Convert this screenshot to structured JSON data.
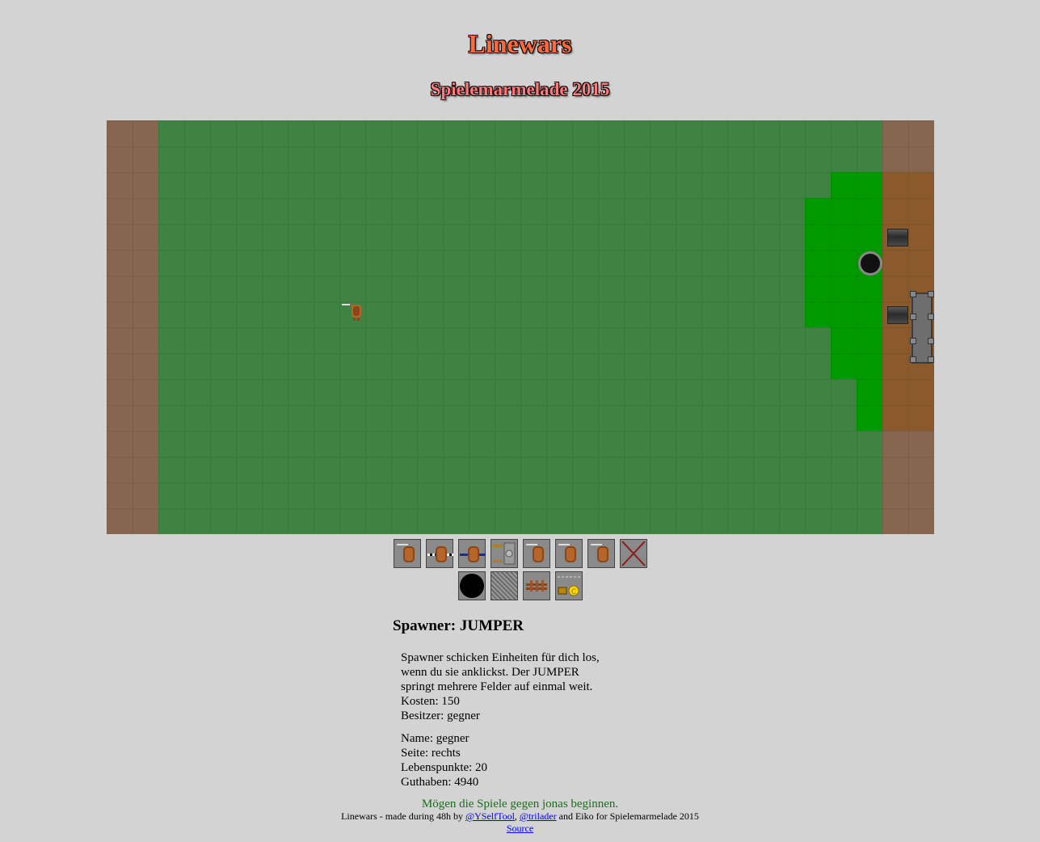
{
  "header": {
    "title": "Linewars",
    "subtitle": "Spielemarmelade 2015"
  },
  "colors": {
    "background": "#d3d3d3",
    "field_grass": "#3f8342",
    "territory_bright_green": "#009900",
    "enemy_dirt": "#8b5a2b",
    "border_dirt": "#86664f",
    "title_orange": "#ff6a3d",
    "greeting_green": "#1e6b1e"
  },
  "board": {
    "icons": [
      "enemy-cannon-icon",
      "black-hole-icon",
      "enemy-base-icon",
      "player-unit-icon"
    ]
  },
  "toolbar": {
    "row1": [
      {
        "name": "spawner-basic-button",
        "icon": "unit-sprite-icon"
      },
      {
        "name": "spawner-jumper-button",
        "icon": "unit-dotted-icon"
      },
      {
        "name": "spawner-line-button",
        "icon": "unit-blue-line-icon"
      },
      {
        "name": "spawner-tank-button",
        "icon": "tank-icon"
      },
      {
        "name": "spawner-unit-5-button",
        "icon": "unit-sprite-icon"
      },
      {
        "name": "spawner-unit-6-button",
        "icon": "unit-sprite-icon"
      },
      {
        "name": "spawner-unit-7-button",
        "icon": "unit-sprite-icon"
      },
      {
        "name": "delete-button",
        "icon": "cross-icon"
      }
    ],
    "row2": [
      {
        "name": "black-hole-button",
        "icon": "black-hole-icon"
      },
      {
        "name": "wall-button",
        "icon": "grid-wall-icon"
      },
      {
        "name": "fence-button",
        "icon": "fence-icon"
      },
      {
        "name": "money-button",
        "icon": "coin-icon"
      }
    ]
  },
  "info": {
    "heading": "Spawner: JUMPER",
    "description": [
      "Spawner schicken Einheiten für dich los,",
      "wenn du sie anklickst. Der JUMPER",
      "springt mehrere Felder auf einmal weit.",
      "Kosten: 150",
      "Besitzer: gegner"
    ],
    "player": [
      "Name: gegner",
      "Seite: rechts",
      "Lebenspunkte: 20",
      "Guthaben: 4940"
    ]
  },
  "greeting": "Mögen die Spiele gegen jonas beginnen.",
  "footer": {
    "prefix": "Linewars - made during 48h by",
    "link1": "@YSelfTool",
    "sep": ",",
    "link2": "@trilader",
    "suffix": "and Eiko for Spielemarmelade 2015",
    "source": "Source"
  }
}
